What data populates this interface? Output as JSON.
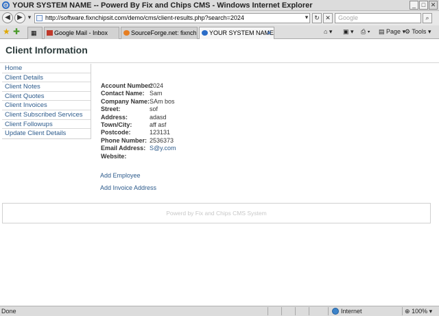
{
  "window": {
    "title": "YOUR SYSTEM NAME -- Powerd By Fix and Chips CMS - Windows Internet Explorer",
    "minimize": "_",
    "maximize": "□",
    "close": "✕"
  },
  "addressbar": {
    "url": "http://software.fixnchipsit.com/demo/cms/client-results.php?search=2024",
    "search_placeholder": "Google",
    "back_glyph": "◀",
    "forward_glyph": "▶",
    "dropdown_glyph": "▾",
    "refresh_glyph": "↻",
    "stop_glyph": "✕",
    "search_glyph": "⌕"
  },
  "tabs": {
    "items": [
      {
        "label": "Google Mail - Inbox",
        "icon": "gmail-icon",
        "color": "#c0392b"
      },
      {
        "label": "SourceForge.net: fixnchipsc...",
        "icon": "firefox-icon",
        "color": "#e67e22"
      },
      {
        "label": "YOUR SYSTEM NAME -- P...",
        "icon": "ie-icon",
        "color": "#2a6cc7"
      }
    ],
    "tab_close": "✕",
    "page_menu": "Page",
    "tools_menu": "Tools"
  },
  "page": {
    "title": "Client Information",
    "sidebar": [
      "Home",
      "Client Details",
      "Client Notes",
      "Client Quotes",
      "Client Invoices",
      "Client Subscribed Services",
      "Client Followups",
      "Update Client Details"
    ],
    "fields": [
      {
        "label": "Account Number:",
        "value": "2024"
      },
      {
        "label": "Contact Name:",
        "value": "Sam"
      },
      {
        "label": "Company Name:",
        "value": "SAm bos"
      },
      {
        "label": "Street:",
        "value": "sof"
      },
      {
        "label": "Address:",
        "value": "adasd"
      },
      {
        "label": "Town/City:",
        "value": "aff asf"
      },
      {
        "label": "Postcode:",
        "value": "123131"
      },
      {
        "label": "Phone Number:",
        "value": "2536373"
      },
      {
        "label": "Email Address:",
        "value": "S@y.com"
      },
      {
        "label": "Website:",
        "value": ""
      }
    ],
    "actions": {
      "add_employee": "Add Employee",
      "add_invoice_address": "Add Invoice Address"
    },
    "footer": "Powerd by Fix and Chips CMS System"
  },
  "statusbar": {
    "status": "Done",
    "zone": "Internet",
    "zoom": "100%"
  },
  "colors": {
    "link": "#2d5b8c",
    "title": "#2b3a3a"
  }
}
